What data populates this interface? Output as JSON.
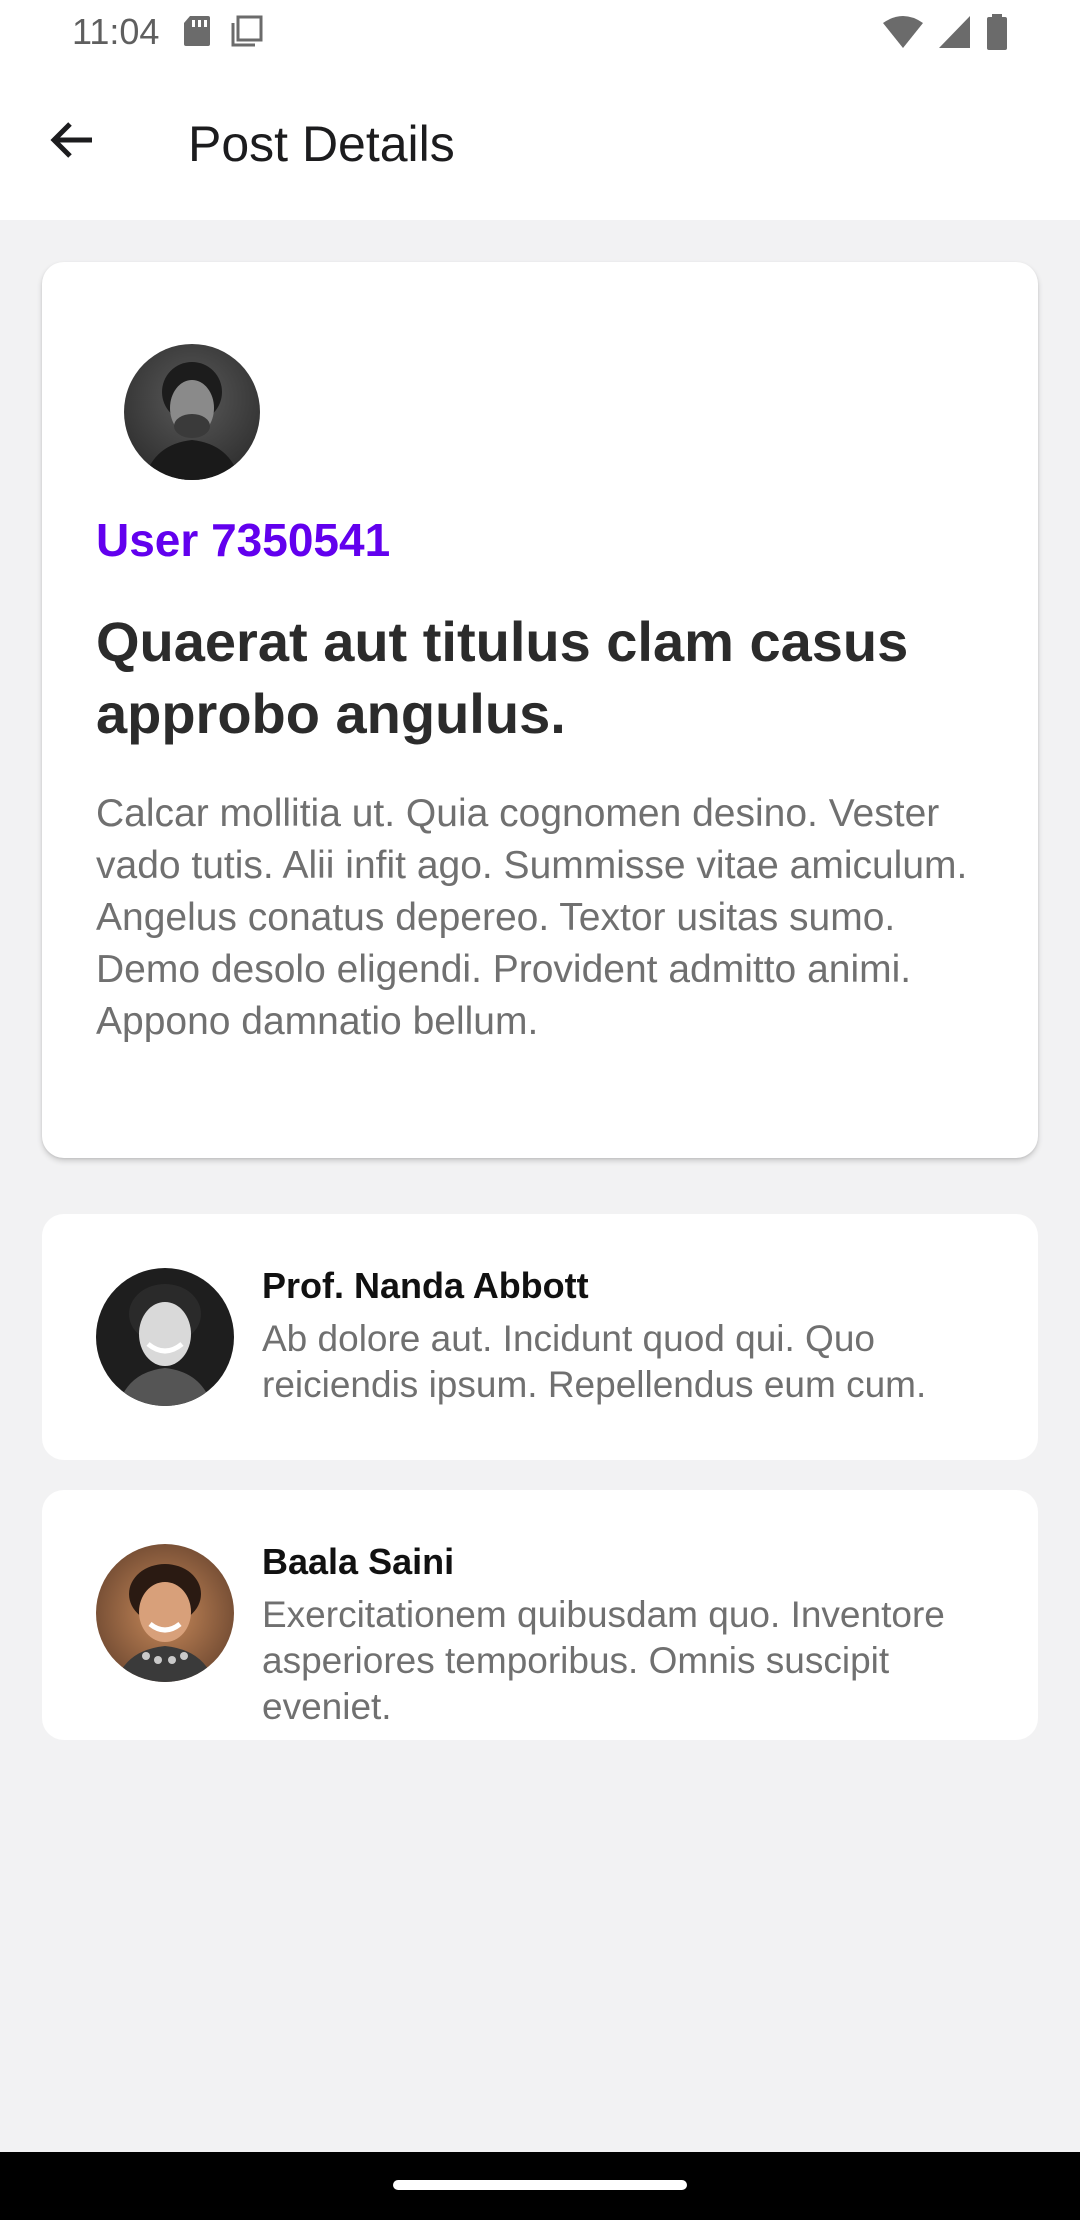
{
  "status_bar": {
    "time": "11:04",
    "icons": [
      "sd-card-icon",
      "screenshot-icon",
      "wifi-icon",
      "signal-icon",
      "battery-icon"
    ]
  },
  "app_bar": {
    "title": "Post Details",
    "back_icon": "arrow-back-icon"
  },
  "post": {
    "author": "User 7350541",
    "title": "Quaerat aut titulus clam casus approbo angulus.",
    "body": "Calcar mollitia ut. Quia cognomen desino. Vester vado tutis. Alii infit ago. Summisse vitae amiculum. Angelus conatus depereo. Textor usitas sumo. Demo desolo eligendi. Provident admitto animi. Appono damnatio bellum."
  },
  "comments": [
    {
      "name": "Prof. Nanda Abbott",
      "text": "Ab dolore aut. Incidunt quod qui. Quo reiciendis ipsum. Repellendus eum cum."
    },
    {
      "name": "Baala Saini",
      "text": "Exercitationem quibusdam quo. Inventore asperiores temporibus. Omnis suscipit eveniet."
    }
  ],
  "colors": {
    "accent": "#6200ee",
    "background": "#f2f2f3",
    "card": "#ffffff",
    "title_text": "#2b2b2b",
    "body_text": "#707070"
  }
}
